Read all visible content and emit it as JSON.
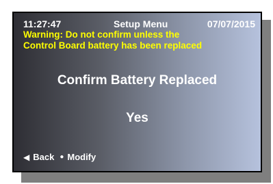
{
  "header": {
    "time": "11:27:47",
    "title": "Setup Menu",
    "date": "07/07/2015"
  },
  "warning": {
    "line1": "Warning: Do not confirm unless the",
    "line2": "Control Board battery has been replaced"
  },
  "prompt": "Confirm Battery Replaced",
  "value": "Yes",
  "footer": {
    "back_icon": "◀",
    "back_label": "Back",
    "modify_icon": "●",
    "modify_label": "Modify"
  },
  "colors": {
    "warning_text": "#ffff00",
    "text": "#ffffff",
    "gradient_left": "#2e2e34",
    "gradient_right": "#b6c2dd",
    "shadow": "#7f7f7f",
    "border": "#000000"
  }
}
